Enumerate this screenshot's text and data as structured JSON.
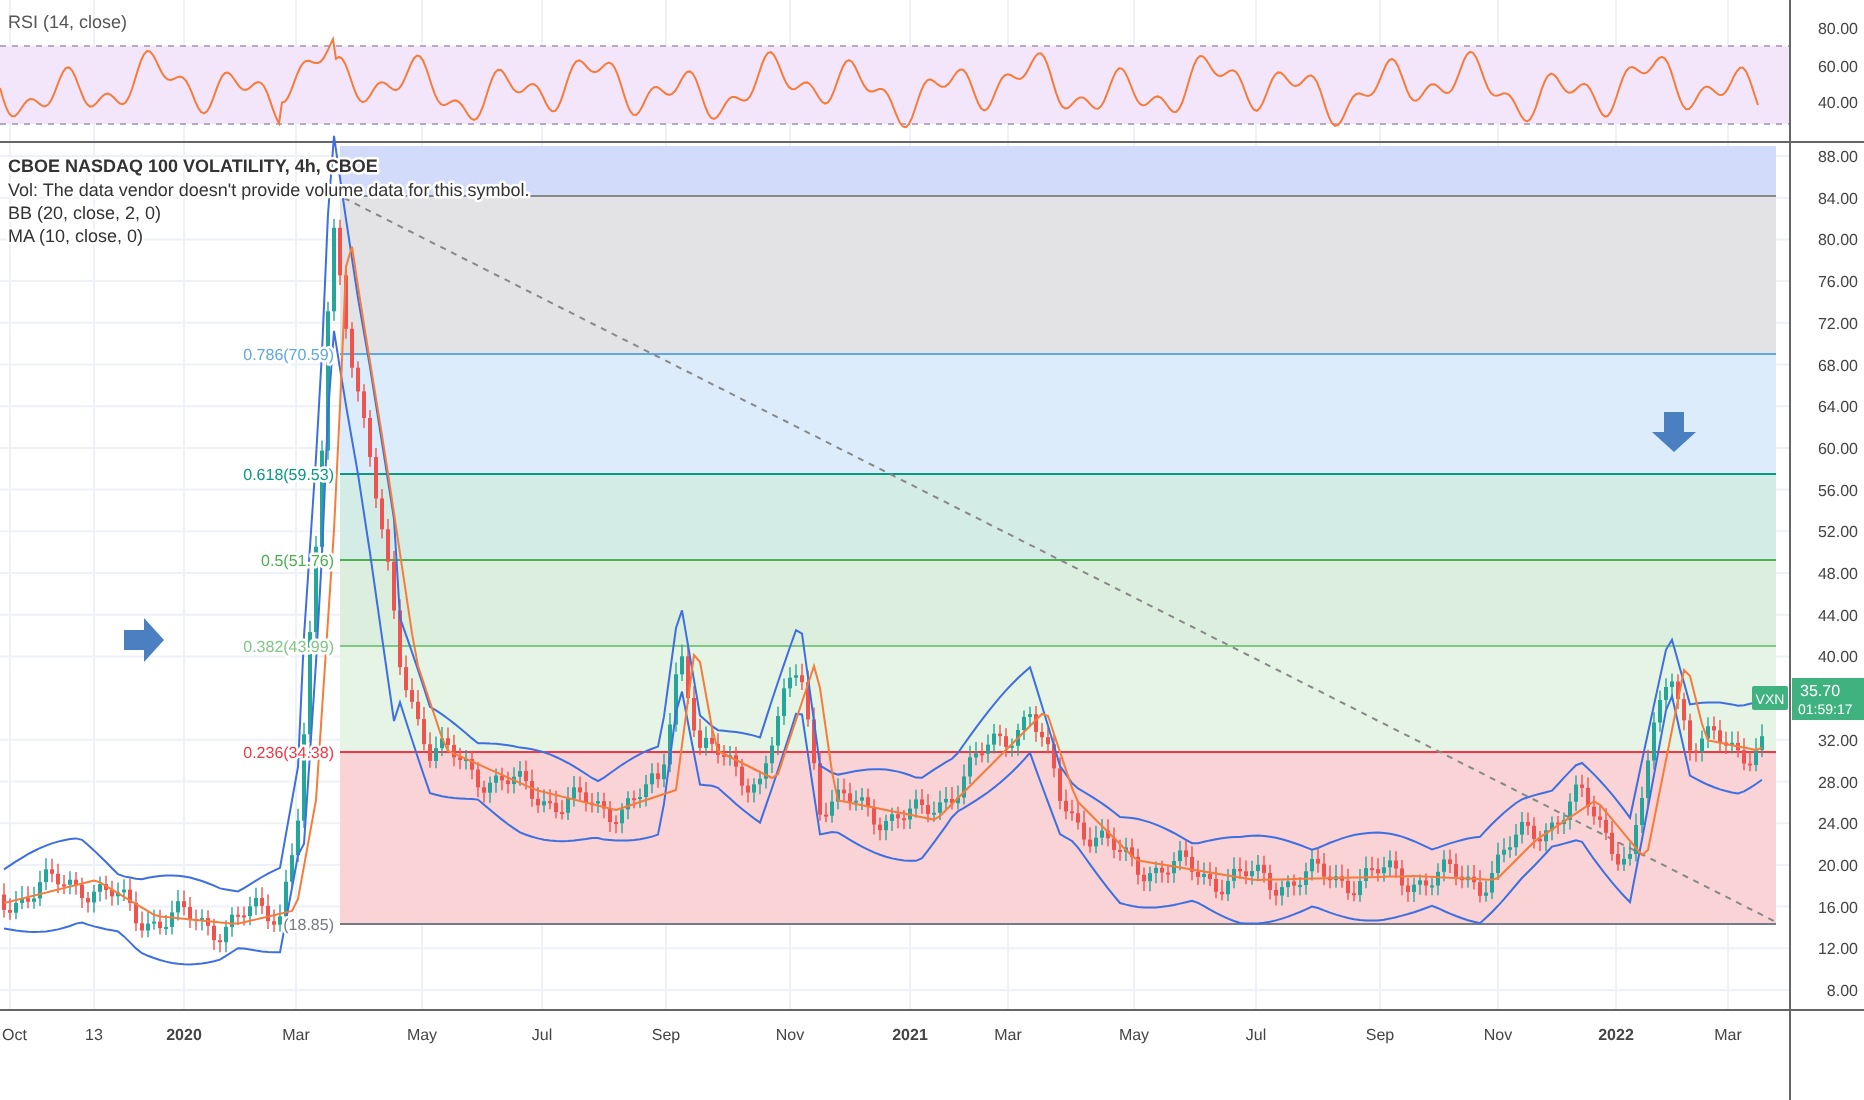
{
  "rsi": {
    "title": "RSI (14, close)",
    "axis": [
      "80.00",
      "60.00",
      "40.00"
    ]
  },
  "legend": {
    "symbol": "CBOE NASDAQ 100 VOLATILITY, 4h, CBOE",
    "lines": [
      "Vol: The data vendor doesn't provide volume data for this symbol.",
      "BB (20, close, 2, 0)",
      "MA (10, close, 0)"
    ]
  },
  "price_axis": [
    "88.00",
    "84.00",
    "80.00",
    "76.00",
    "72.00",
    "68.00",
    "64.00",
    "60.00",
    "56.00",
    "52.00",
    "48.00",
    "44.00",
    "40.00",
    "32.00",
    "28.00",
    "24.00",
    "20.00",
    "16.00",
    "12.00",
    "8.00"
  ],
  "time_axis": [
    {
      "label": "Oct",
      "kind": "month"
    },
    {
      "label": "13",
      "kind": "month"
    },
    {
      "label": "2020",
      "kind": "year"
    },
    {
      "label": "Mar",
      "kind": "month"
    },
    {
      "label": "May",
      "kind": "month"
    },
    {
      "label": "Jul",
      "kind": "month"
    },
    {
      "label": "Sep",
      "kind": "month"
    },
    {
      "label": "Nov",
      "kind": "month"
    },
    {
      "label": "2021",
      "kind": "year"
    },
    {
      "label": "Mar",
      "kind": "month"
    },
    {
      "label": "May",
      "kind": "month"
    },
    {
      "label": "Jul",
      "kind": "month"
    },
    {
      "label": "Sep",
      "kind": "month"
    },
    {
      "label": "Nov",
      "kind": "month"
    },
    {
      "label": "2022",
      "kind": "year"
    },
    {
      "label": "Mar",
      "kind": "month"
    }
  ],
  "fib_levels": [
    {
      "label": "0.786(70.59)",
      "color": "#5fa8e0"
    },
    {
      "label": "0.618(59.53)",
      "color": "#089981"
    },
    {
      "label": "0.5(51.76)",
      "color": "#4caf50"
    },
    {
      "label": "0.382(43.99)",
      "color": "#81c784"
    },
    {
      "label": "0.236(34.38)",
      "color": "#f23645"
    },
    {
      "label": "(18.85)",
      "color": "#787b86"
    }
  ],
  "price_tag": {
    "symbol": "VXN",
    "price": "35.70",
    "countdown": "01:59:17"
  }
}
